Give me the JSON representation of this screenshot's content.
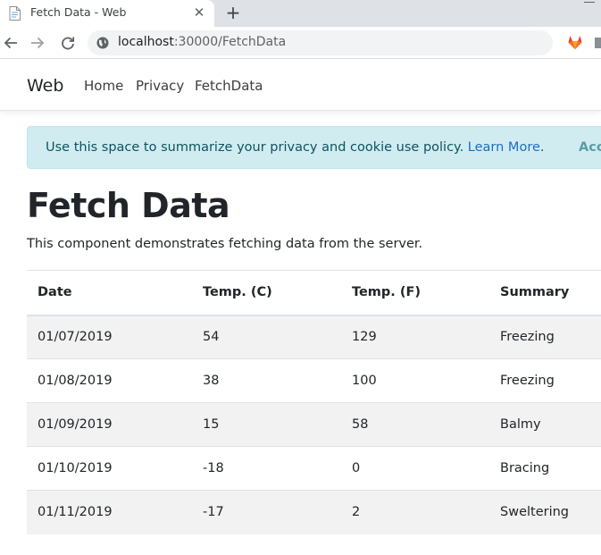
{
  "browser": {
    "tab_title": "Fetch Data - Web",
    "url_host": "localhost",
    "url_rest": ":30000/FetchData"
  },
  "navbar": {
    "brand": "Web",
    "links": [
      "Home",
      "Privacy",
      "FetchData"
    ]
  },
  "cookie": {
    "message": "Use this space to summarize your privacy and cookie use policy. ",
    "link": "Learn More",
    "link_suffix": ".",
    "accept": "Accept"
  },
  "page": {
    "title": "Fetch Data",
    "description": "This component demonstrates fetching data from the server."
  },
  "table": {
    "headers": [
      "Date",
      "Temp. (C)",
      "Temp. (F)",
      "Summary"
    ],
    "rows": [
      [
        "01/07/2019",
        "54",
        "129",
        "Freezing"
      ],
      [
        "01/08/2019",
        "38",
        "100",
        "Freezing"
      ],
      [
        "01/09/2019",
        "15",
        "58",
        "Balmy"
      ],
      [
        "01/10/2019",
        "-18",
        "0",
        "Bracing"
      ],
      [
        "01/11/2019",
        "-17",
        "2",
        "Sweltering"
      ]
    ]
  },
  "icons": {
    "tab_favicon": "document-icon",
    "tab_close": "close-icon",
    "new_tab": "plus-icon",
    "back": "arrow-left-icon",
    "forward": "arrow-right-icon",
    "reload": "reload-icon",
    "site_info": "globe-icon",
    "extension": "gitlab-fox-icon"
  },
  "colors": {
    "alert_bg": "#d1ecf1",
    "alert_text": "#0c5460",
    "link": "#1b6ec2",
    "stripe": "#f2f2f2"
  }
}
